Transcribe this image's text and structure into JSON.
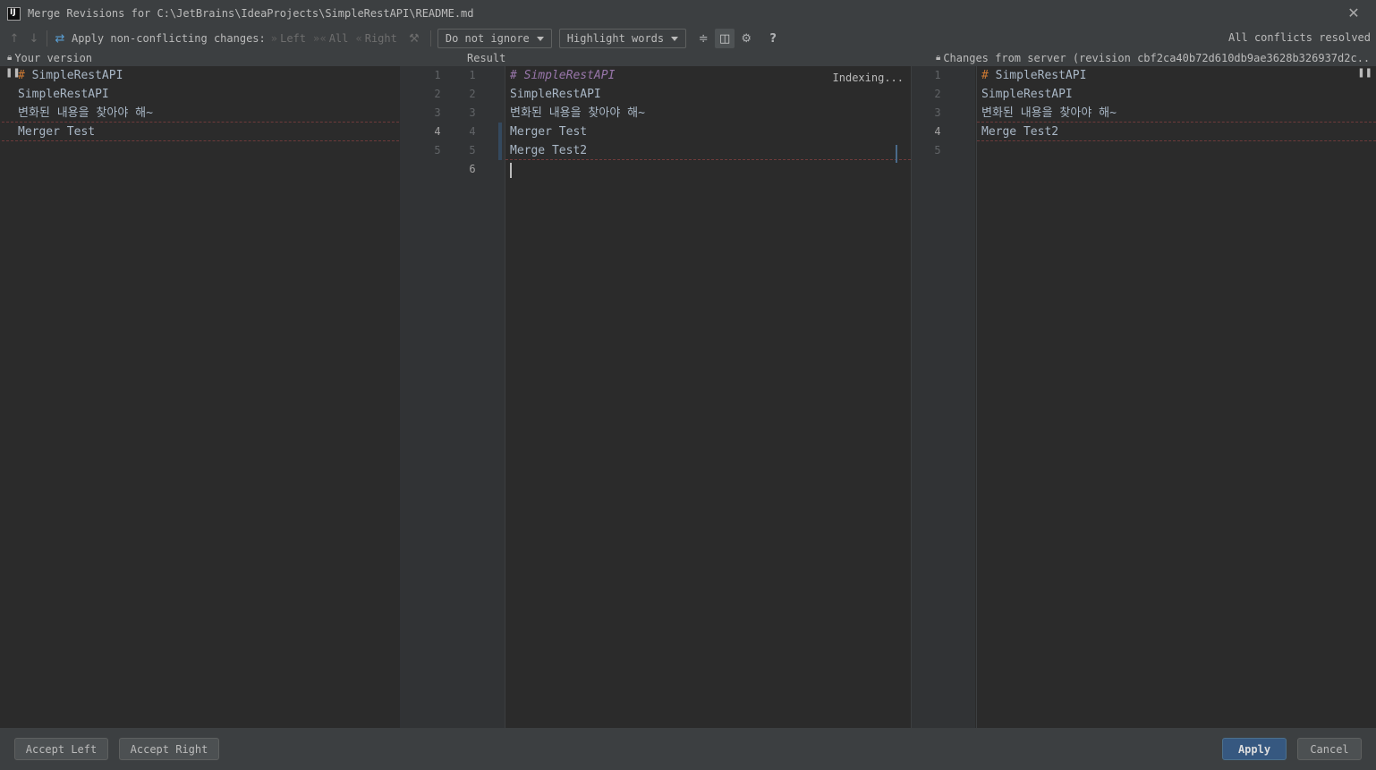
{
  "window": {
    "title": "Merge Revisions for C:\\JetBrains\\IdeaProjects\\SimpleRestAPI\\README.md",
    "logo_text": "IJ"
  },
  "toolbar": {
    "apply_label": "Apply non-conflicting changes:",
    "left_label": "Left",
    "all_label": "All",
    "right_label": "Right",
    "ignore_combo": "Do not ignore",
    "highlight_combo": "Highlight words",
    "help": "?",
    "status": "All conflicts resolved"
  },
  "left_panel": {
    "header": "Your version",
    "lines": [
      {
        "n": "1",
        "prefix": "#",
        "text": " SimpleRestAPI"
      },
      {
        "n": "2",
        "prefix": "",
        "text": "SimpleRestAPI"
      },
      {
        "n": "3",
        "prefix": "",
        "text": "변화된 내용을 찾아야 해~"
      },
      {
        "n": "4",
        "prefix": "",
        "text": "Merger Test"
      },
      {
        "n": "5",
        "prefix": "",
        "text": ""
      }
    ]
  },
  "result_panel": {
    "header": "Result",
    "indexing": "Indexing...",
    "lines": [
      {
        "n": "1",
        "text": "# SimpleRestAPI"
      },
      {
        "n": "2",
        "text": "SimpleRestAPI"
      },
      {
        "n": "3",
        "text": "변화된 내용을 찾아야 해~"
      },
      {
        "n": "4",
        "text": "Merger Test"
      },
      {
        "n": "5",
        "text": "Merge Test2"
      },
      {
        "n": "6",
        "text": ""
      }
    ]
  },
  "right_panel": {
    "header": "Changes from server (revision cbf2ca40b72d610db9ae3628b326937d2c...",
    "lines": [
      {
        "n": "1",
        "prefix": "#",
        "text": " SimpleRestAPI"
      },
      {
        "n": "2",
        "prefix": "",
        "text": "SimpleRestAPI"
      },
      {
        "n": "3",
        "prefix": "",
        "text": "변화된 내용을 찾아야 해~"
      },
      {
        "n": "4",
        "prefix": "",
        "text": "Merge Test2"
      },
      {
        "n": "5",
        "prefix": "",
        "text": ""
      }
    ]
  },
  "buttons": {
    "accept_left": "Accept Left",
    "accept_right": "Accept Right",
    "apply": "Apply",
    "cancel": "Cancel"
  },
  "icons": {
    "prev": "arrow-up-icon",
    "next": "arrow-down-icon",
    "magic": "magic-resolve-icon",
    "collapse": "collapse-unchanged-icon",
    "sync": "sync-scroll-icon",
    "settings": "gear-icon",
    "help": "help-icon",
    "close": "close-icon"
  }
}
